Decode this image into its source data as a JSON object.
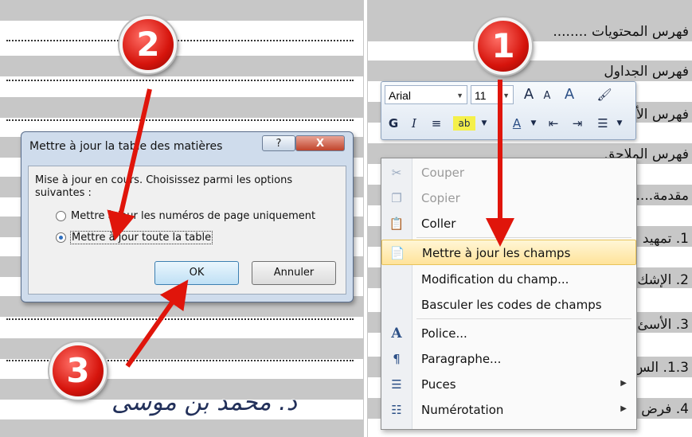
{
  "dialog": {
    "title": "Mettre à jour la table des matières",
    "help_label": "?",
    "close_label": "X",
    "message": "Mise à jour en cours. Choisissez parmi les options suivantes :",
    "option_page_numbers": "Mettre à jour les numéros de page uniquement",
    "option_entire_table": "Mettre à jour toute la table",
    "ok_label": "OK",
    "cancel_label": "Annuler"
  },
  "markers": {
    "one": "1",
    "two": "2",
    "three": "3"
  },
  "signature": "د. محمد بن موسى",
  "document": {
    "toc_lines": [
      "فهرس المحتويات ........",
      "فهرس الجداول",
      "فهرس الأ",
      "فهرس الملاحق",
      "مقدمة.....",
      "1. تمهيد",
      "2. الإشك",
      "3. الأسئ",
      "1.3. الس",
      "4. فرض"
    ]
  },
  "mini_toolbar": {
    "font_name": "Arial",
    "font_size": "11",
    "grow_font": "A",
    "shrink_font": "A",
    "bold": "G",
    "italic": "I"
  },
  "context_menu": {
    "items": [
      {
        "label": "Couper"
      },
      {
        "label": "Copier"
      },
      {
        "label": "Coller"
      },
      {
        "label": "Mettre à jour les champs"
      },
      {
        "label": "Modification du champ..."
      },
      {
        "label": "Basculer les codes de champs"
      },
      {
        "label": "Police..."
      },
      {
        "label": "Paragraphe..."
      },
      {
        "label": "Puces"
      },
      {
        "label": "Numérotation"
      }
    ]
  },
  "colors": {
    "marker_red": "#d6140c",
    "highlight": "#ffe39a",
    "dialog_frame": "#cfdcec"
  }
}
